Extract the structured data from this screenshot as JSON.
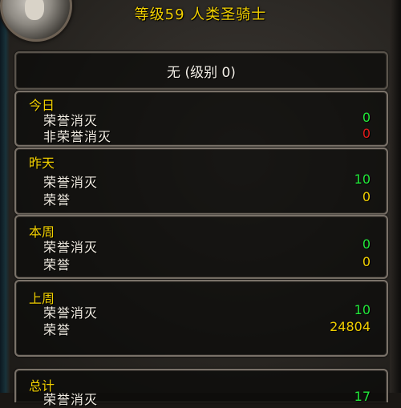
{
  "header": {
    "title": "等级59 人类圣骑士"
  },
  "rank": {
    "text": "无 (级别 0)"
  },
  "today": {
    "title": "今日",
    "rows": [
      {
        "label": "荣誉消灭",
        "value": "0"
      },
      {
        "label": "非荣誉消灭",
        "value": "0"
      }
    ]
  },
  "yesterday": {
    "title": "昨天",
    "rows": [
      {
        "label": "荣誉消灭",
        "value": "10"
      },
      {
        "label": "荣誉",
        "value": "0"
      }
    ]
  },
  "this_week": {
    "title": "本周",
    "rows": [
      {
        "label": "荣誉消灭",
        "value": "0"
      },
      {
        "label": "荣誉",
        "value": "0"
      }
    ]
  },
  "last_week": {
    "title": "上周",
    "rows": [
      {
        "label": "荣誉消灭",
        "value": "10"
      },
      {
        "label": "荣誉",
        "value": "24804"
      }
    ]
  },
  "total": {
    "title": "总计",
    "rows": [
      {
        "label": "荣誉消灭",
        "value": "17"
      }
    ]
  },
  "icons": {
    "portrait": "character-portrait-icon"
  },
  "colors": {
    "title": "#f2d000",
    "positive": "#22e83a",
    "negative": "#e21a1a",
    "label": "#f2ede3"
  }
}
